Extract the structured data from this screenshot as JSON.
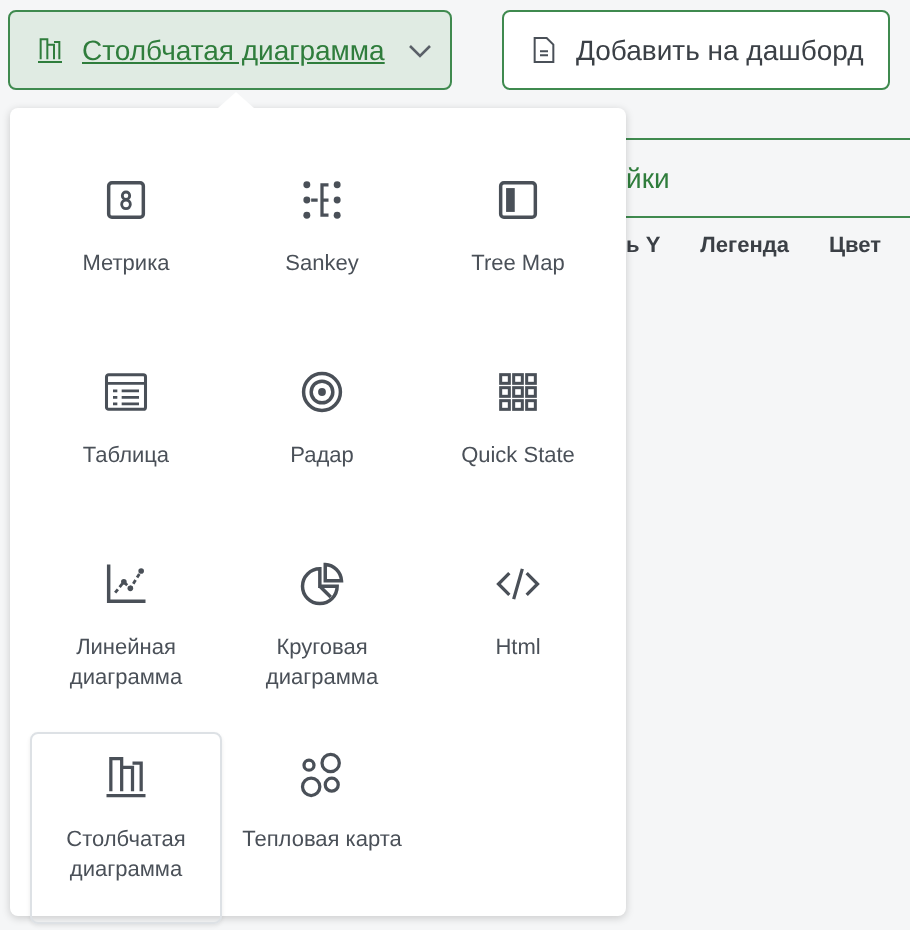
{
  "toolbar": {
    "chart_type_button": {
      "label": "Столбчатая диаграмма",
      "expanded": true
    },
    "add_button": {
      "label": "Добавить на дашборд"
    }
  },
  "settings_panel": {
    "tab": "йки",
    "columns": [
      "ь Y",
      "Легенда",
      "Цвет"
    ]
  },
  "chart_menu": {
    "items": [
      {
        "kind": "metric",
        "label": "Метрика",
        "selected": false
      },
      {
        "kind": "sankey",
        "label": "Sankey",
        "selected": false
      },
      {
        "kind": "treemap",
        "label": "Tree Map",
        "selected": false
      },
      {
        "kind": "table",
        "label": "Таблица",
        "selected": false
      },
      {
        "kind": "radar",
        "label": "Радар",
        "selected": false
      },
      {
        "kind": "grid",
        "label": "Quick State",
        "selected": false
      },
      {
        "kind": "line",
        "label": "Линейная диаграмма",
        "selected": false
      },
      {
        "kind": "pie",
        "label": "Круговая диаграмма",
        "selected": false
      },
      {
        "kind": "code",
        "label": "Html",
        "selected": false
      },
      {
        "kind": "bar",
        "label": "Столбчатая диаграмма",
        "selected": true
      },
      {
        "kind": "bubbles",
        "label": "Тепловая карта",
        "selected": false
      }
    ]
  }
}
